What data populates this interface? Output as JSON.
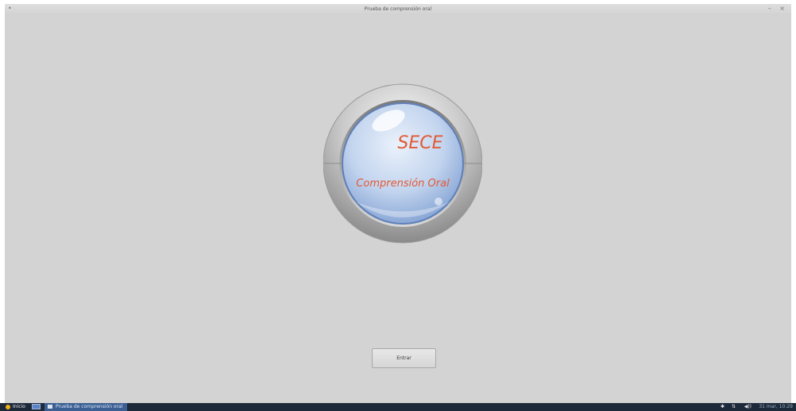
{
  "window": {
    "title": "Prueba de comprensión oral",
    "menu_symbol": "•",
    "controls": "– ×"
  },
  "logo": {
    "title": "SECE",
    "subtitle": "Comprensión Oral",
    "text_color": "#e25a36"
  },
  "actions": {
    "enter_label": "Entrar"
  },
  "taskbar": {
    "start_label": "Inicio",
    "task_label": "Prueba de comprensión oral",
    "tray": {
      "bluetooth": "✱",
      "network": "⇅",
      "volume": "◀))",
      "clock": "31 mar, 10:29"
    }
  }
}
